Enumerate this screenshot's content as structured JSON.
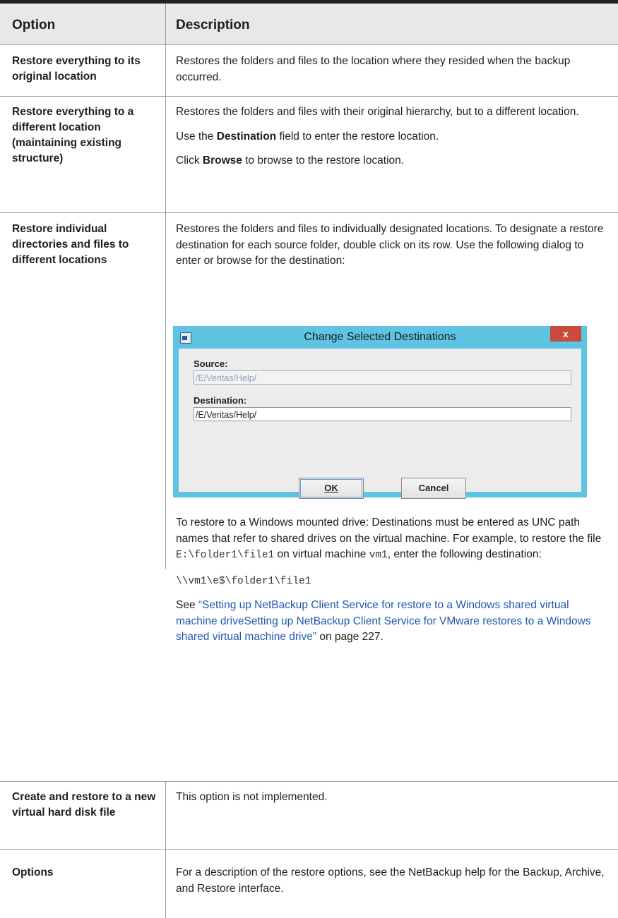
{
  "table": {
    "headers": [
      "Option",
      "Description"
    ],
    "rows": [
      {
        "option": "Restore everything to its original location",
        "description": "Restores the folders and files to the location where they resided when the backup occurred."
      },
      {
        "option": "Restore everything to a different location (maintaining existing structure)",
        "description": "Restores the folders and files with their original hierarchy, but to a different location.",
        "dest_pre": "Use the ",
        "dest_bold": "Destination",
        "dest_post": " field to enter the restore location.",
        "browse_pre": "Click ",
        "browse_bold": "Browse",
        "browse_post": " to browse to the restore location."
      },
      {
        "option": "Restore individual directories and files to different locations",
        "description": "Restores the folders and files to individually designated locations. To designate a restore destination for each source folder, double click on its row. Use the following dialog to enter or browse for the destination:",
        "unc_text_1": "To restore to a Windows mounted drive: Destinations must be entered as UNC path names that refer to shared drives on the virtual machine. For example, to restore the file ",
        "unc_code_1": "E:\\folder1\\file1",
        "unc_text_2": " on virtual machine ",
        "unc_code_2": "vm1",
        "unc_text_3": ", enter the following destination:",
        "unc_example": "\\\\vm1\\e$\\folder1\\file1",
        "see_pre": "See ",
        "see_link": "“Setting up NetBackup Client Service for restore to a Windows shared virtual machine driveSetting up NetBackup Client Service for VMware restores to a Windows shared virtual machine drive”",
        "see_post": " on page 227."
      },
      {
        "option": "Create and restore to a new virtual hard disk file",
        "description": "This option is not implemented."
      },
      {
        "option": "Options",
        "description": "For a description of the restore options, see the NetBackup help for the Backup, Archive, and Restore interface."
      }
    ]
  },
  "dialog": {
    "title": "Change Selected Destinations",
    "close_glyph": "x",
    "source_label": "Source:",
    "source_value": "/E/Veritas/Help/",
    "destination_label": "Destination:",
    "destination_value": "/E/Veritas/Help/",
    "ok_label": "OK",
    "cancel_label": "Cancel",
    "accent_color": "#5fc3e4"
  }
}
